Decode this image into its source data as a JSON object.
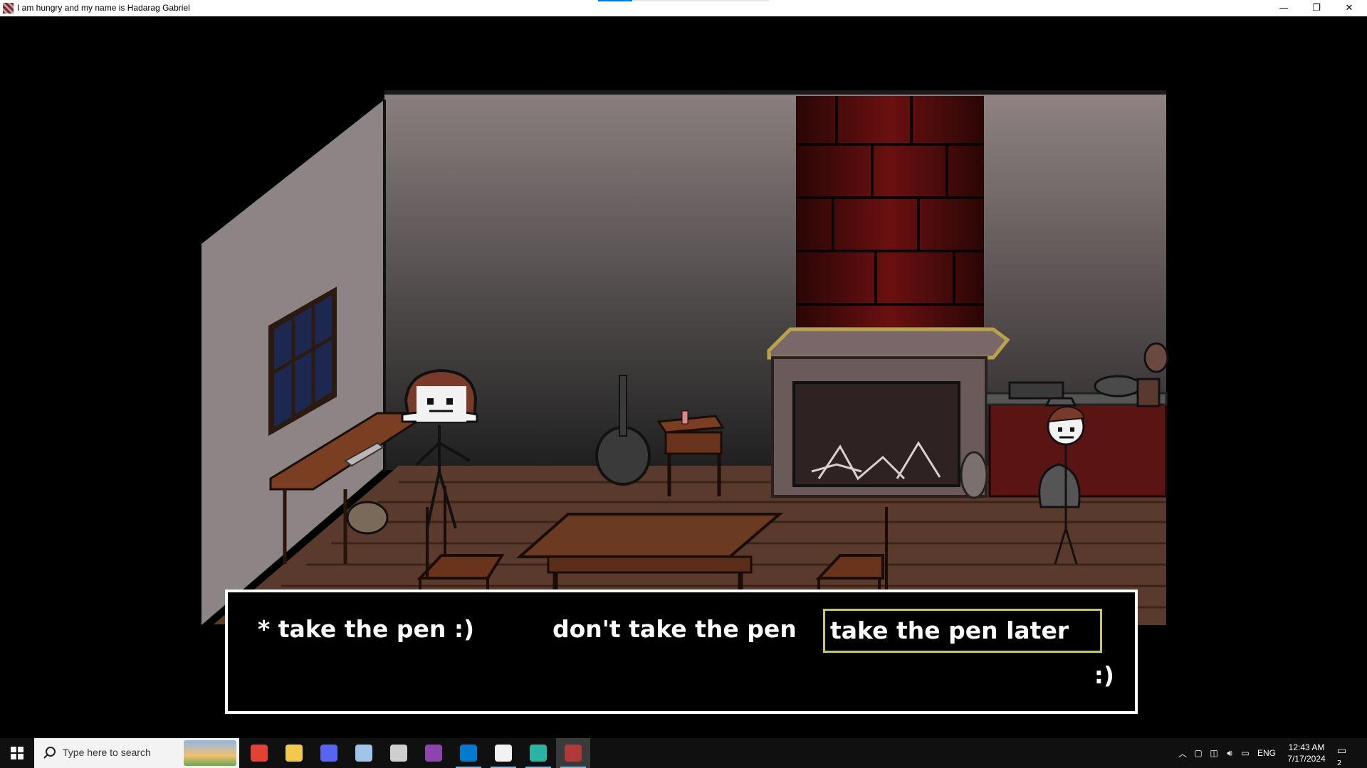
{
  "window": {
    "title": "I am hungry and my name is Hadarag Gabriel",
    "controls": {
      "minimize": "—",
      "maximize": "❐",
      "close": "✕"
    }
  },
  "scene": {
    "colors": {
      "floor": "#5a3a2c",
      "floor_lines": "#3a2418",
      "back_wall_top": "#8a7c7c",
      "back_wall_bottom": "#2a2a2a",
      "side_wall": "#8f8686",
      "brick": "#5a0c0c",
      "fireplace": "#6a5a5a",
      "gold_trim": "#b9a24a",
      "wood": "#7a3e22"
    }
  },
  "dialogue": {
    "choices": [
      {
        "label": "* take the pen :)",
        "selected": false
      },
      {
        "label": "don't take the pen",
        "selected": false
      },
      {
        "label": "take the pen later",
        "selected": true
      }
    ],
    "speaker_face": ":)"
  },
  "taskbar": {
    "search_placeholder": "Type here to search",
    "apps": [
      {
        "name": "chrome-icon",
        "color": "#e34133"
      },
      {
        "name": "file-explorer-icon",
        "color": "#f2c94c"
      },
      {
        "name": "discord-icon",
        "color": "#5865f2"
      },
      {
        "name": "paint-icon",
        "color": "#9fc5e8"
      },
      {
        "name": "printer-icon",
        "color": "#cfcfcf"
      },
      {
        "name": "winrar-icon",
        "color": "#8e44ad"
      },
      {
        "name": "vscode-icon",
        "color": "#007acc"
      },
      {
        "name": "twitch-icon",
        "color": "#f2f2f2"
      },
      {
        "name": "app-teal-icon",
        "color": "#2bb3a3"
      },
      {
        "name": "game-icon",
        "color": "#b03a3a"
      }
    ],
    "tray": {
      "language": "ENG",
      "time": "12:43 AM",
      "date": "7/17/2024",
      "notification_count": "2"
    }
  }
}
